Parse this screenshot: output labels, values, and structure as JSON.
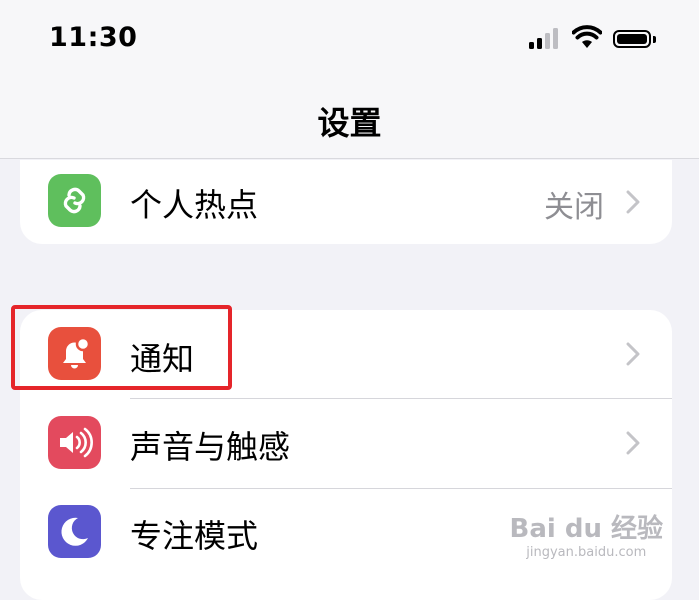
{
  "status_bar": {
    "time": "11:30"
  },
  "nav": {
    "title": "设置"
  },
  "group1": {
    "rows": [
      {
        "label": "个人热点",
        "value": "关闭",
        "icon": "hotspot-icon",
        "color": "#5fbf5d"
      }
    ]
  },
  "group2": {
    "rows": [
      {
        "label": "通知",
        "icon": "notification-bell-icon",
        "color": "#e8503d"
      },
      {
        "label": "声音与触感",
        "icon": "speaker-icon",
        "color": "#e34a5e"
      },
      {
        "label": "专注模式",
        "icon": "moon-icon",
        "color": "#5b57cf"
      }
    ]
  },
  "highlight": {
    "color": "#e5252a"
  },
  "watermark": {
    "brand": "Bai du 经验",
    "url": "jingyan.baidu.com"
  }
}
